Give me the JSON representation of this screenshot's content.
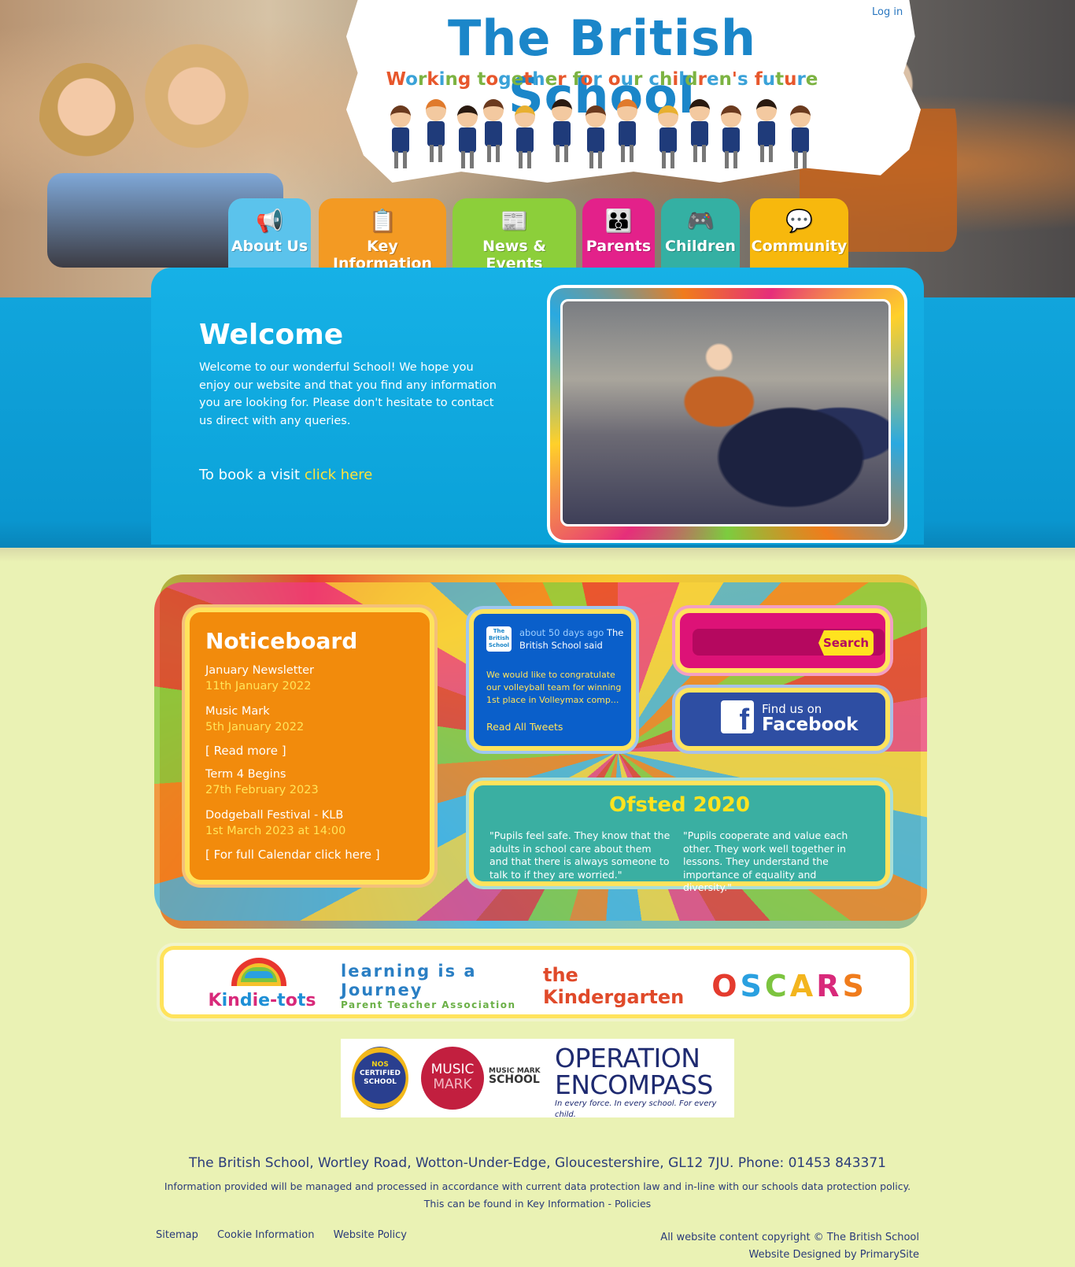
{
  "header": {
    "title": "The British School",
    "tagline": "Working together for our children's future",
    "login": "Log in"
  },
  "nav": [
    {
      "label": "About Us",
      "icon": "megaphone-icon",
      "color": "#5bc3ec"
    },
    {
      "label": "Key Information",
      "icon": "clipboard-icon",
      "color": "#f39a23"
    },
    {
      "label": "News & Events",
      "icon": "newspaper-icon",
      "color": "#8ccf3a"
    },
    {
      "label": "Parents",
      "icon": "parents-icon",
      "color": "#e3218a"
    },
    {
      "label": "Children",
      "icon": "gamepad-icon",
      "color": "#34b0a3"
    },
    {
      "label": "Community",
      "icon": "speech-bubble-icon",
      "color": "#f7b80d"
    }
  ],
  "welcome": {
    "title": "Welcome",
    "text": "Welcome to our wonderful School! We hope you enjoy our website and that you find any information you are looking for. Please don't hesitate to contact us direct with any queries.",
    "book_prefix": "To book a visit ",
    "book_link": "click here"
  },
  "noticeboard": {
    "title": "Noticeboard",
    "items": [
      {
        "title": "January Newsletter",
        "date": "11th January 2022"
      },
      {
        "title": "Music Mark",
        "date": "5th January 2022"
      }
    ],
    "read_more": "[ Read more ]",
    "events": [
      {
        "title": "Term 4 Begins",
        "date": "27th February 2023"
      },
      {
        "title": "Dodgeball Festival - KLB",
        "date": "1st March 2023 at 14:00"
      }
    ],
    "calendar_link": "[ For full Calendar click here ]"
  },
  "tweet": {
    "avatar_text": "The British School",
    "ago": "about 50 days ago",
    "author": "The British School said",
    "body": "We would like to congratulate our volleyball team for winning 1st place in Volleymax comp...",
    "read_all": "Read All Tweets"
  },
  "search": {
    "placeholder": "",
    "button": "Search"
  },
  "facebook": {
    "small": "Find us on",
    "large": "Facebook"
  },
  "ofsted": {
    "title": "Ofsted 2020",
    "quote1": "\"Pupils feel safe. They know that the adults in school care about them and that there is always someone to talk to if they are worried.\"",
    "quote2": "\"Pupils cooperate and value each other. They work well together in lessons. They understand the importance of equality and diversity.\""
  },
  "partners": {
    "kindie": "Kindie-tots",
    "journey_line1": "learning is a Journey",
    "journey_line2": "Parent Teacher Association",
    "kinder": "the Kindergarten",
    "oscars": "OSCARS"
  },
  "accreditations": {
    "nos_line1": "NOS",
    "nos_line2": "CERTIFIED",
    "nos_line3": "SCHOOL",
    "mm_line1": "MUSIC",
    "mm_line2": "MARK",
    "mm_school_line1": "MUSIC MARK",
    "mm_school_line2": "SCHOOL",
    "op_line1": "OPERATION",
    "op_line2": "ENCOMPASS",
    "op_tagline": "In every force. In every school. For every child."
  },
  "footer": {
    "address": "The British School, Wortley Road, Wotton-Under-Edge, Gloucestershire, GL12 7JU. Phone: 01453 843371",
    "info1": "Information provided will be managed and processed in accordance with current data protection law and in-line with our schools data protection policy.",
    "info2": "This can be found in Key Information - Policies",
    "links": [
      "Sitemap",
      "Cookie Information",
      "Website Policy"
    ],
    "copyright": "All website content copyright © The British School",
    "designed": "Website Designed by PrimarySite"
  }
}
